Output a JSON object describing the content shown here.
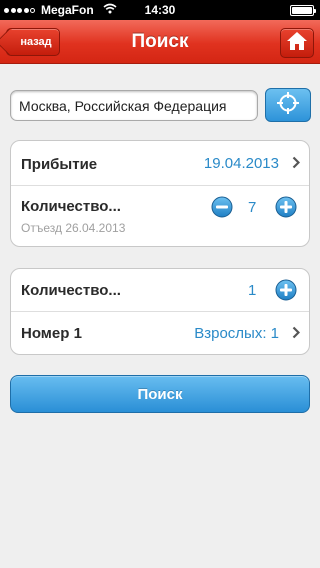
{
  "status_bar": {
    "carrier": "MegaFon",
    "time": "14:30",
    "battery_level": 1.0,
    "signal_bars": 4
  },
  "nav": {
    "title": "Поиск",
    "back_label": "назад",
    "home_icon": "home-icon"
  },
  "search": {
    "location_value": "Москва, Российская Федерация",
    "geo_icon": "crosshair-icon"
  },
  "group1": {
    "arrival_label": "Прибытие",
    "arrival_date": "19.04.2013",
    "nights_label": "Количество...",
    "nights_value": "7",
    "departure_note": "Отъезд 26.04.2013"
  },
  "group2": {
    "rooms_label": "Количество...",
    "rooms_value": "1",
    "room_label": "Номер 1",
    "room_guests": "Взрослых: 1"
  },
  "search_button": "Поиск",
  "colors": {
    "nav_red": "#e0321f",
    "accent_blue": "#2a8ac8",
    "button_blue": "#3a9be0"
  }
}
